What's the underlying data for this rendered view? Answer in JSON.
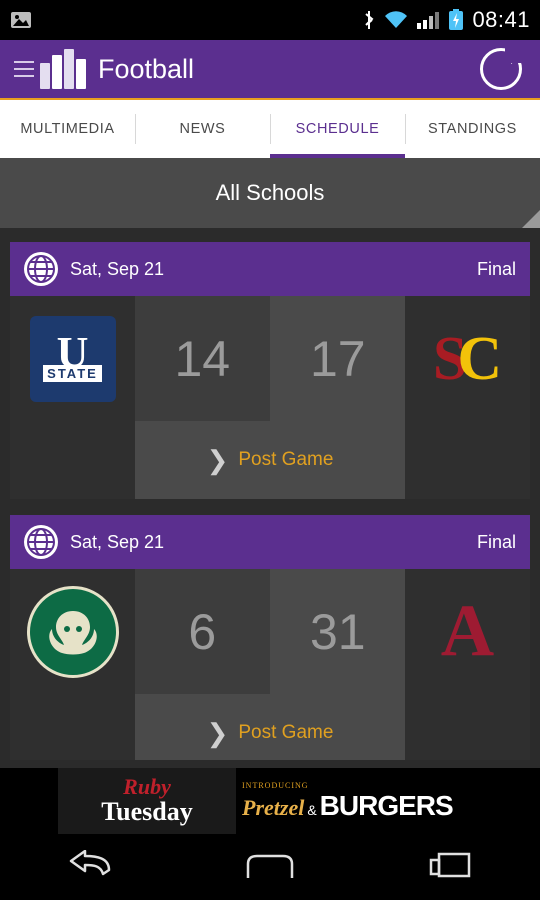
{
  "statusbar": {
    "time": "08:41",
    "icons": [
      "image-icon",
      "bluetooth-icon",
      "wifi-icon",
      "signal-icon",
      "battery-icon"
    ]
  },
  "appbar": {
    "title": "Football",
    "menu_icon": "hamburger-icon",
    "logo_icon": "stadium-logo-icon",
    "refresh_icon": "refresh-icon"
  },
  "tabs": [
    {
      "label": "MULTIMEDIA",
      "active": false
    },
    {
      "label": "NEWS",
      "active": false
    },
    {
      "label": "SCHEDULE",
      "active": true
    },
    {
      "label": "STANDINGS",
      "active": false
    }
  ],
  "filter": {
    "label": "All Schools",
    "resize_icon": "resize-handle-icon"
  },
  "games": [
    {
      "date": "Sat, Sep 21",
      "status": "Final",
      "globe_icon": "globe-icon",
      "away": {
        "name": "Utah State",
        "score": "14",
        "logo": "utah-state-logo"
      },
      "home": {
        "name": "USC",
        "score": "17",
        "logo": "usc-logo"
      },
      "action": {
        "label": "Post Game",
        "icon": "chevron-right-icon"
      }
    },
    {
      "date": "Sat, Sep 21",
      "status": "Final",
      "globe_icon": "globe-icon",
      "away": {
        "name": "Colorado State",
        "score": "6",
        "logo": "colorado-state-logo"
      },
      "home": {
        "name": "Alabama",
        "score": "31",
        "logo": "alabama-logo"
      },
      "action": {
        "label": "Post Game",
        "icon": "chevron-right-icon"
      }
    }
  ],
  "ad": {
    "brand_line1": "Ruby",
    "brand_line2": "Tuesday",
    "intro": "INTRODUCING",
    "item1": "Pretzel",
    "amp": "&",
    "item2": "BURGERS"
  },
  "navbar": {
    "back": "back-icon",
    "home": "home-icon",
    "recents": "recents-icon"
  },
  "colors": {
    "brand_purple": "#5b2f8f",
    "accent_gold": "#e0a020",
    "bar_background": "#4a4a4a"
  }
}
